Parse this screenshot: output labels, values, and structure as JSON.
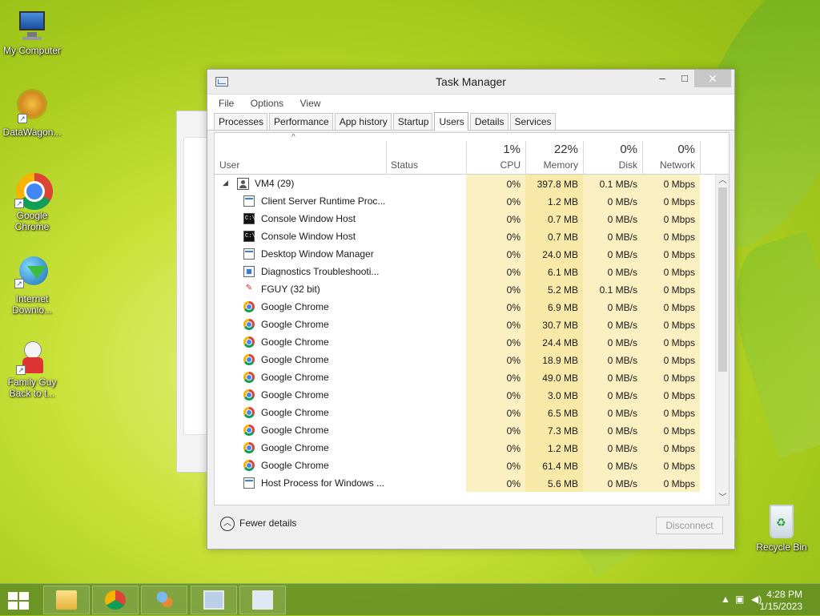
{
  "desktop": {
    "icons": [
      {
        "label": "My Computer"
      },
      {
        "label": "DataWagon..."
      },
      {
        "label": "Google Chrome"
      },
      {
        "label": "Internet Downlo..."
      },
      {
        "label": "Family Guy Back to t..."
      }
    ],
    "recycle_bin": "Recycle Bin"
  },
  "window": {
    "title": "Task Manager",
    "controls": {
      "minimize": "–",
      "maximize": "□",
      "close": "✕"
    },
    "menu": [
      "File",
      "Options",
      "View"
    ],
    "tabs": [
      {
        "label": "Processes"
      },
      {
        "label": "Performance"
      },
      {
        "label": "App history"
      },
      {
        "label": "Startup"
      },
      {
        "label": "Users",
        "active": true
      },
      {
        "label": "Details"
      },
      {
        "label": "Services"
      }
    ],
    "columns": {
      "user": "User",
      "status": "Status",
      "cpu": {
        "pct": "1%",
        "label": "CPU"
      },
      "memory": {
        "pct": "22%",
        "label": "Memory"
      },
      "disk": {
        "pct": "0%",
        "label": "Disk"
      },
      "network": {
        "pct": "0%",
        "label": "Network"
      }
    },
    "group": {
      "name": "VM4 (29)",
      "cpu": "0%",
      "memory": "397.8 MB",
      "disk": "0.1 MB/s",
      "network": "0 Mbps"
    },
    "processes": [
      {
        "name": "Client Server Runtime Proc...",
        "icon": "window-icon",
        "cpu": "0%",
        "memory": "1.2 MB",
        "disk": "0 MB/s",
        "network": "0 Mbps"
      },
      {
        "name": "Console Window Host",
        "icon": "console-icon",
        "cpu": "0%",
        "memory": "0.7 MB",
        "disk": "0 MB/s",
        "network": "0 Mbps"
      },
      {
        "name": "Console Window Host",
        "icon": "console-icon",
        "cpu": "0%",
        "memory": "0.7 MB",
        "disk": "0 MB/s",
        "network": "0 Mbps"
      },
      {
        "name": "Desktop Window Manager",
        "icon": "window-icon",
        "cpu": "0%",
        "memory": "24.0 MB",
        "disk": "0 MB/s",
        "network": "0 Mbps"
      },
      {
        "name": "Diagnostics Troubleshooti...",
        "icon": "diagnostics-icon",
        "cpu": "0%",
        "memory": "6.1 MB",
        "disk": "0 MB/s",
        "network": "0 Mbps"
      },
      {
        "name": "FGUY (32 bit)",
        "icon": "fguy-icon",
        "cpu": "0%",
        "memory": "5.2 MB",
        "disk": "0.1 MB/s",
        "network": "0 Mbps"
      },
      {
        "name": "Google Chrome",
        "icon": "chrome-icon",
        "cpu": "0%",
        "memory": "6.9 MB",
        "disk": "0 MB/s",
        "network": "0 Mbps"
      },
      {
        "name": "Google Chrome",
        "icon": "chrome-icon",
        "cpu": "0%",
        "memory": "30.7 MB",
        "disk": "0 MB/s",
        "network": "0 Mbps"
      },
      {
        "name": "Google Chrome",
        "icon": "chrome-icon",
        "cpu": "0%",
        "memory": "24.4 MB",
        "disk": "0 MB/s",
        "network": "0 Mbps"
      },
      {
        "name": "Google Chrome",
        "icon": "chrome-icon",
        "cpu": "0%",
        "memory": "18.9 MB",
        "disk": "0 MB/s",
        "network": "0 Mbps"
      },
      {
        "name": "Google Chrome",
        "icon": "chrome-icon",
        "cpu": "0%",
        "memory": "49.0 MB",
        "disk": "0 MB/s",
        "network": "0 Mbps"
      },
      {
        "name": "Google Chrome",
        "icon": "chrome-icon",
        "cpu": "0%",
        "memory": "3.0 MB",
        "disk": "0 MB/s",
        "network": "0 Mbps"
      },
      {
        "name": "Google Chrome",
        "icon": "chrome-icon",
        "cpu": "0%",
        "memory": "6.5 MB",
        "disk": "0 MB/s",
        "network": "0 Mbps"
      },
      {
        "name": "Google Chrome",
        "icon": "chrome-icon",
        "cpu": "0%",
        "memory": "7.3 MB",
        "disk": "0 MB/s",
        "network": "0 Mbps"
      },
      {
        "name": "Google Chrome",
        "icon": "chrome-icon",
        "cpu": "0%",
        "memory": "1.2 MB",
        "disk": "0 MB/s",
        "network": "0 Mbps"
      },
      {
        "name": "Google Chrome",
        "icon": "chrome-icon",
        "cpu": "0%",
        "memory": "61.4 MB",
        "disk": "0 MB/s",
        "network": "0 Mbps"
      },
      {
        "name": "Host Process for Windows ...",
        "icon": "window-icon",
        "cpu": "0%",
        "memory": "5.6 MB",
        "disk": "0 MB/s",
        "network": "0 Mbps"
      }
    ],
    "footer": {
      "fewer_details": "Fewer details",
      "disconnect": "Disconnect"
    }
  },
  "taskbar": {
    "apps": [
      "file-explorer-icon",
      "chrome-icon",
      "people-icon",
      "performance-monitor-icon",
      "task-manager-icon"
    ],
    "clock": {
      "time": "4:28 PM",
      "date": "1/15/2023"
    }
  }
}
